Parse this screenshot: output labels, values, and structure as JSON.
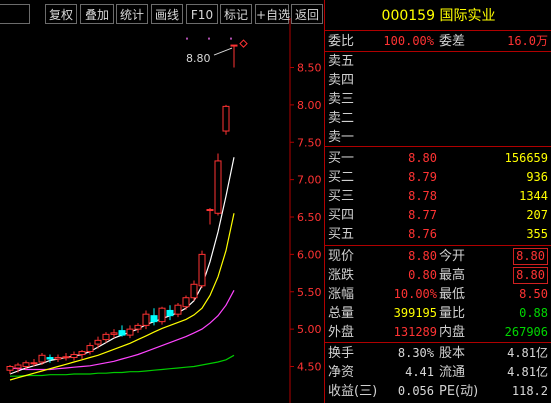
{
  "toolbar": {
    "buttons": [
      "复权",
      "叠加",
      "统计",
      "画线",
      "F10",
      "标记",
      "+自选",
      "返回"
    ]
  },
  "stock": {
    "code": "000159",
    "name": "国际实业"
  },
  "weibi": {
    "label": "委比",
    "value": "100.00%",
    "diff_label": "委差",
    "diff_value": "16.0万"
  },
  "sell": [
    {
      "label": "卖五",
      "price": "",
      "volume": ""
    },
    {
      "label": "卖四",
      "price": "",
      "volume": ""
    },
    {
      "label": "卖三",
      "price": "",
      "volume": ""
    },
    {
      "label": "卖二",
      "price": "",
      "volume": ""
    },
    {
      "label": "卖一",
      "price": "",
      "volume": ""
    }
  ],
  "buy": [
    {
      "label": "买一",
      "price": "8.80",
      "volume": "156659"
    },
    {
      "label": "买二",
      "price": "8.79",
      "volume": "936"
    },
    {
      "label": "买三",
      "price": "8.78",
      "volume": "1344"
    },
    {
      "label": "买四",
      "price": "8.77",
      "volume": "207"
    },
    {
      "label": "买五",
      "price": "8.76",
      "volume": "355"
    }
  ],
  "quote": {
    "xianjia": {
      "label": "现价",
      "value": "8.80"
    },
    "jinkai": {
      "label": "今开",
      "value": "8.80"
    },
    "zhangdie": {
      "label": "涨跌",
      "value": "0.80"
    },
    "zuigao": {
      "label": "最高",
      "value": "8.80"
    },
    "zhangfu": {
      "label": "涨幅",
      "value": "10.00%"
    },
    "zuidi": {
      "label": "最低",
      "value": "8.50"
    },
    "zongliang": {
      "label": "总量",
      "value": "399195"
    },
    "liangbi": {
      "label": "量比",
      "value": "0.88"
    },
    "waipan": {
      "label": "外盘",
      "value": "131289"
    },
    "neipan": {
      "label": "内盘",
      "value": "267906"
    }
  },
  "stats": {
    "huanshou": {
      "label": "换手",
      "value": "8.30%"
    },
    "guben": {
      "label": "股本",
      "value": "4.81亿"
    },
    "jingzi": {
      "label": "净资",
      "value": "4.41"
    },
    "liutong": {
      "label": "流通",
      "value": "4.81亿"
    },
    "shouyi": {
      "label": "收益(三)",
      "value": "0.056"
    },
    "pe": {
      "label": "PE(动)",
      "value": "118.2"
    }
  },
  "colors": {
    "up": "#ff3333",
    "down": "#00ffff",
    "ma5": "#ffffff",
    "ma10": "#ffff00",
    "ma20": "#ff44ff",
    "ma60": "#00cc00",
    "axis": "#b00000"
  },
  "chart_data": {
    "type": "candlestick",
    "ylim": [
      4.4,
      8.85
    ],
    "y_ticks": [
      "8.50",
      "8.00",
      "7.50",
      "7.00",
      "6.50",
      "6.00",
      "5.50",
      "5.00",
      "4.50"
    ],
    "tick_values": [
      8.5,
      8.0,
      7.5,
      7.0,
      6.5,
      6.0,
      5.5,
      5.0,
      4.5
    ],
    "max_label": "8.80",
    "candles": [
      {
        "o": 4.45,
        "h": 4.52,
        "l": 4.4,
        "c": 4.5
      },
      {
        "o": 4.48,
        "h": 4.55,
        "l": 4.42,
        "c": 4.52
      },
      {
        "o": 4.5,
        "h": 4.58,
        "l": 4.46,
        "c": 4.55
      },
      {
        "o": 4.55,
        "h": 4.6,
        "l": 4.5,
        "c": 4.55
      },
      {
        "o": 4.56,
        "h": 4.68,
        "l": 4.52,
        "c": 4.65
      },
      {
        "o": 4.62,
        "h": 4.66,
        "l": 4.55,
        "c": 4.6
      },
      {
        "o": 4.6,
        "h": 4.66,
        "l": 4.56,
        "c": 4.62
      },
      {
        "o": 4.62,
        "h": 4.68,
        "l": 4.58,
        "c": 4.63
      },
      {
        "o": 4.62,
        "h": 4.7,
        "l": 4.58,
        "c": 4.66
      },
      {
        "o": 4.66,
        "h": 4.72,
        "l": 4.6,
        "c": 4.7
      },
      {
        "o": 4.7,
        "h": 4.82,
        "l": 4.66,
        "c": 4.78
      },
      {
        "o": 4.8,
        "h": 4.9,
        "l": 4.74,
        "c": 4.85
      },
      {
        "o": 4.86,
        "h": 4.96,
        "l": 4.82,
        "c": 4.93
      },
      {
        "o": 4.93,
        "h": 5.0,
        "l": 4.88,
        "c": 4.95
      },
      {
        "o": 4.98,
        "h": 5.05,
        "l": 4.9,
        "c": 4.92
      },
      {
        "o": 4.92,
        "h": 5.05,
        "l": 4.88,
        "c": 5.0
      },
      {
        "o": 5.0,
        "h": 5.08,
        "l": 4.95,
        "c": 5.05
      },
      {
        "o": 5.05,
        "h": 5.25,
        "l": 5.0,
        "c": 5.2
      },
      {
        "o": 5.18,
        "h": 5.28,
        "l": 5.05,
        "c": 5.1
      },
      {
        "o": 5.1,
        "h": 5.3,
        "l": 5.06,
        "c": 5.28
      },
      {
        "o": 5.25,
        "h": 5.32,
        "l": 5.12,
        "c": 5.18
      },
      {
        "o": 5.2,
        "h": 5.35,
        "l": 5.16,
        "c": 5.32
      },
      {
        "o": 5.3,
        "h": 5.45,
        "l": 5.26,
        "c": 5.42
      },
      {
        "o": 5.42,
        "h": 5.65,
        "l": 5.38,
        "c": 5.6
      },
      {
        "o": 5.58,
        "h": 6.05,
        "l": 5.55,
        "c": 6.0
      },
      {
        "o": 6.6,
        "h": 6.62,
        "l": 6.4,
        "c": 6.6
      },
      {
        "o": 6.55,
        "h": 7.35,
        "l": 6.52,
        "c": 7.25
      },
      {
        "o": 7.65,
        "h": 8.0,
        "l": 7.6,
        "c": 7.98
      },
      {
        "o": 8.8,
        "h": 8.8,
        "l": 8.5,
        "c": 8.8
      }
    ],
    "ma5": [
      4.4,
      4.44,
      4.48,
      4.51,
      4.54,
      4.58,
      4.6,
      4.62,
      4.64,
      4.66,
      4.7,
      4.76,
      4.82,
      4.88,
      4.92,
      4.96,
      5.0,
      5.06,
      5.1,
      5.14,
      5.18,
      5.22,
      5.28,
      5.38,
      5.58,
      5.9,
      6.3,
      6.78,
      7.3
    ],
    "ma10": [
      4.32,
      4.35,
      4.38,
      4.41,
      4.44,
      4.47,
      4.5,
      4.53,
      4.56,
      4.59,
      4.62,
      4.65,
      4.69,
      4.73,
      4.77,
      4.81,
      4.86,
      4.91,
      4.96,
      5.01,
      5.05,
      5.09,
      5.13,
      5.19,
      5.28,
      5.45,
      5.7,
      6.05,
      6.55
    ],
    "ma20": [
      4.48,
      4.47,
      4.46,
      4.46,
      4.46,
      4.46,
      4.47,
      4.48,
      4.49,
      4.5,
      4.51,
      4.53,
      4.55,
      4.57,
      4.6,
      4.63,
      4.66,
      4.7,
      4.74,
      4.78,
      4.82,
      4.86,
      4.9,
      4.95,
      5.0,
      5.08,
      5.18,
      5.32,
      5.52
    ],
    "ma60": [
      4.37,
      4.37,
      4.38,
      4.38,
      4.38,
      4.39,
      4.39,
      4.39,
      4.4,
      4.4,
      4.4,
      4.41,
      4.41,
      4.42,
      4.42,
      4.43,
      4.43,
      4.44,
      4.45,
      4.46,
      4.47,
      4.48,
      4.49,
      4.5,
      4.52,
      4.54,
      4.56,
      4.59,
      4.65
    ]
  }
}
